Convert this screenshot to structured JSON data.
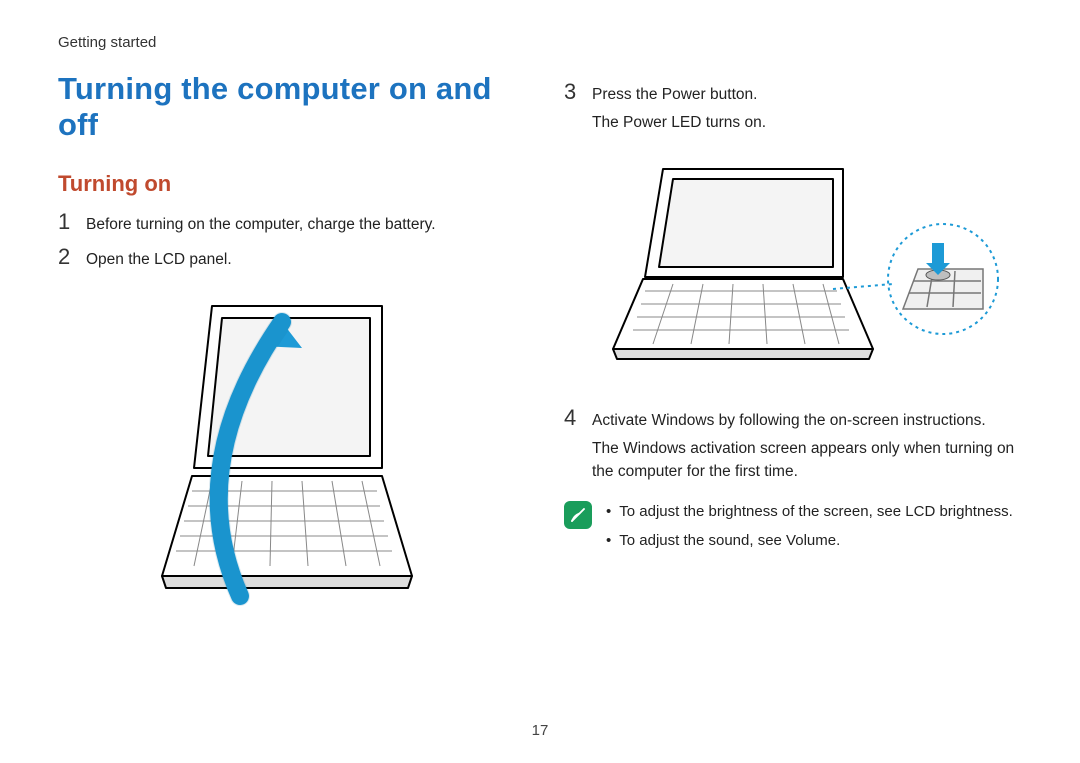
{
  "header": "Getting started",
  "title": "Turning the computer on and off",
  "section": "Turning on",
  "steps": {
    "s1": {
      "num": "1",
      "text": "Before turning on the computer, charge the battery."
    },
    "s2": {
      "num": "2",
      "text": "Open the LCD panel."
    },
    "s3": {
      "num": "3",
      "text": "Press the Power button.",
      "sub": "The Power LED turns on."
    },
    "s4": {
      "num": "4",
      "text": "Activate Windows by following the on-screen instructions.",
      "sub": "The Windows activation screen appears only when turning on the computer for the first time."
    }
  },
  "notes": {
    "n1": "To adjust the brightness of the screen, see LCD brightness.",
    "n2": "To adjust the sound, see Volume."
  },
  "page_number": "17"
}
